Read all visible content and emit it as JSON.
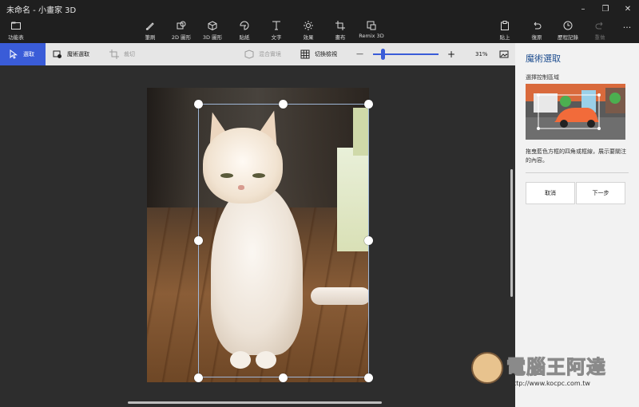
{
  "app": {
    "title": "未命名 - 小畫家 3D"
  },
  "window_controls": {
    "minimize": "–",
    "maximize": "❐",
    "close": "✕"
  },
  "cmdbar": {
    "menu": "功能表",
    "brushes": "筆刷",
    "shapes2d": "2D 圖形",
    "shapes3d": "3D 圖形",
    "stickers": "貼紙",
    "text": "文字",
    "effects": "效果",
    "canvas": "畫布",
    "remix": "Remix 3D",
    "paste": "貼上",
    "undo": "復原",
    "history": "歷程記錄",
    "redo": "重做",
    "more": "···"
  },
  "toolbar2": {
    "select": "選取",
    "magic_select": "魔術選取",
    "crop": "裁切",
    "mixed_reality": "混合實境",
    "toggle_view": "切換檢視",
    "zoom_minus": "—",
    "zoom_plus": "+",
    "zoom_percent": "31%",
    "zoom_level": 0.31
  },
  "panel": {
    "title": "魔術選取",
    "subtitle": "選擇控制區域",
    "description": "拖曳藍色方框的四角或框線，展示要關注的內容。",
    "cancel": "取消",
    "next": "下一步"
  },
  "watermark": {
    "brand": "電腦王阿達",
    "url": "http://www.kocpc.com.tw"
  },
  "colors": {
    "accent": "#3a5cd8",
    "panel_title": "#1d4d8f",
    "chrome": "#1f1f1f"
  }
}
